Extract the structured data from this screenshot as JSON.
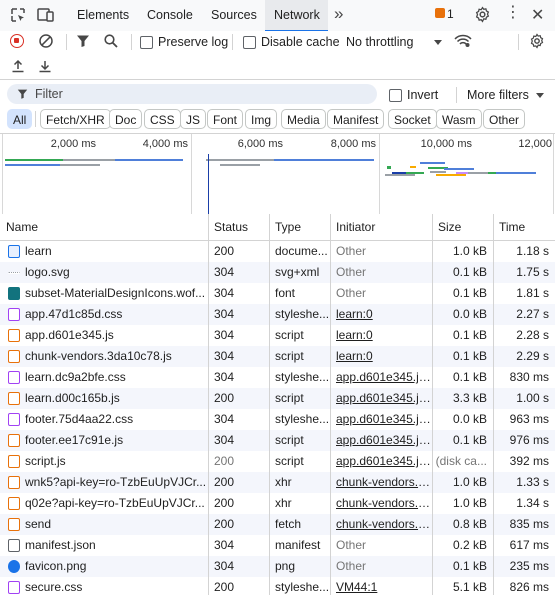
{
  "tabs": [
    {
      "label": "Elements",
      "active": false
    },
    {
      "label": "Console",
      "active": false
    },
    {
      "label": "Sources",
      "active": false
    },
    {
      "label": "Network",
      "active": true
    }
  ],
  "tabbar": {
    "more_tabs": "»",
    "issues_count": "1"
  },
  "toolbar": {
    "preserve_log": "Preserve log",
    "disable_cache": "Disable cache",
    "throttling": "No throttling"
  },
  "filter": {
    "placeholder": "Filter",
    "invert": "Invert",
    "more_filters": "More filters"
  },
  "chips": [
    "All",
    "Fetch/XHR",
    "Doc",
    "CSS",
    "JS",
    "Font",
    "Img",
    "Media",
    "Manifest",
    "Socket",
    "Wasm",
    "Other"
  ],
  "overview": {
    "ticks": [
      "2,000 ms",
      "4,000 ms",
      "6,000 ms",
      "8,000 ms",
      "10,000 ms",
      "12,000"
    ]
  },
  "columns": [
    "Name",
    "Status",
    "Type",
    "Initiator",
    "Size",
    "Time"
  ],
  "rows": [
    {
      "name": "learn",
      "status": "200",
      "type": "docume...",
      "initiator": "Other",
      "init_link": false,
      "size": "1.0 kB",
      "time": "1.18 s",
      "icon": "document"
    },
    {
      "name": "logo.svg",
      "status": "304",
      "type": "svg+xml",
      "initiator": "Other",
      "init_link": false,
      "size": "0.1 kB",
      "time": "1.75 s",
      "icon": "image"
    },
    {
      "name": "subset-MaterialDesignIcons.wof...",
      "status": "304",
      "type": "font",
      "initiator": "Other",
      "init_link": false,
      "size": "0.1 kB",
      "time": "1.81 s",
      "icon": "font"
    },
    {
      "name": "app.47d1c85d.css",
      "status": "304",
      "type": "styleshe...",
      "initiator": "learn:0",
      "init_link": true,
      "size": "0.0 kB",
      "time": "2.27 s",
      "icon": "stylesheet"
    },
    {
      "name": "app.d601e345.js",
      "status": "304",
      "type": "script",
      "initiator": "learn:0",
      "init_link": true,
      "size": "0.1 kB",
      "time": "2.28 s",
      "icon": "script"
    },
    {
      "name": "chunk-vendors.3da10c78.js",
      "status": "304",
      "type": "script",
      "initiator": "learn:0",
      "init_link": true,
      "size": "0.1 kB",
      "time": "2.29 s",
      "icon": "script"
    },
    {
      "name": "learn.dc9a2bfe.css",
      "status": "304",
      "type": "styleshe...",
      "initiator": "app.d601e345.js:1...",
      "init_link": true,
      "size": "0.1 kB",
      "time": "830 ms",
      "icon": "stylesheet"
    },
    {
      "name": "learn.d00c165b.js",
      "status": "200",
      "type": "script",
      "initiator": "app.d601e345.js:1...",
      "init_link": true,
      "size": "3.3 kB",
      "time": "1.00 s",
      "icon": "script"
    },
    {
      "name": "footer.75d4aa22.css",
      "status": "304",
      "type": "styleshe...",
      "initiator": "app.d601e345.js:1...",
      "init_link": true,
      "size": "0.0 kB",
      "time": "963 ms",
      "icon": "stylesheet"
    },
    {
      "name": "footer.ee17c91e.js",
      "status": "304",
      "type": "script",
      "initiator": "app.d601e345.js:1...",
      "init_link": true,
      "size": "0.1 kB",
      "time": "976 ms",
      "icon": "script"
    },
    {
      "name": "script.js",
      "status": "200",
      "type": "script",
      "initiator": "app.d601e345.js:1...",
      "init_link": true,
      "size": "(disk ca...",
      "time": "392 ms",
      "icon": "script",
      "muted_status": true,
      "muted_size": true
    },
    {
      "name": "wnk5?api-key=ro-TzbEuUpVJCr...",
      "status": "200",
      "type": "xhr",
      "initiator": "chunk-vendors.3da...",
      "init_link": true,
      "size": "1.0 kB",
      "time": "1.33 s",
      "icon": "xhr"
    },
    {
      "name": "q02e?api-key=ro-TzbEuUpVJCr...",
      "status": "200",
      "type": "xhr",
      "initiator": "chunk-vendors.3da...",
      "init_link": true,
      "size": "1.0 kB",
      "time": "1.34 s",
      "icon": "xhr"
    },
    {
      "name": "send",
      "status": "200",
      "type": "fetch",
      "initiator": "chunk-vendors.3da...",
      "init_link": true,
      "size": "0.8 kB",
      "time": "835 ms",
      "icon": "xhr"
    },
    {
      "name": "manifest.json",
      "status": "304",
      "type": "manifest",
      "initiator": "Other",
      "init_link": false,
      "size": "0.2 kB",
      "time": "617 ms",
      "icon": "manifest"
    },
    {
      "name": "favicon.png",
      "status": "304",
      "type": "png",
      "initiator": "Other",
      "init_link": false,
      "size": "0.1 kB",
      "time": "235 ms",
      "icon": "favicon"
    },
    {
      "name": "secure.css",
      "status": "200",
      "type": "styleshe...",
      "initiator": "VM44:1",
      "init_link": true,
      "size": "5.1 kB",
      "time": "826 ms",
      "icon": "stylesheet"
    }
  ]
}
